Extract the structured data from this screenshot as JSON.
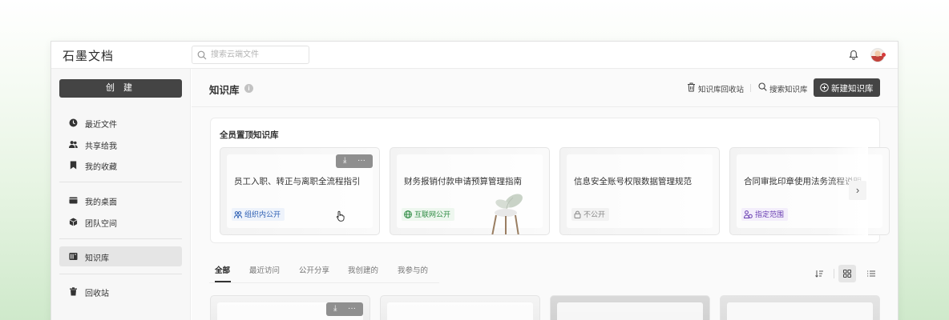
{
  "app": {
    "logo": "石墨文档"
  },
  "search": {
    "placeholder": "搜索云端文件"
  },
  "sidebar": {
    "create_label": "创 建",
    "items": [
      {
        "label": "最近文件",
        "icon": "clock-icon"
      },
      {
        "label": "共享给我",
        "icon": "users-icon"
      },
      {
        "label": "我的收藏",
        "icon": "bookmark-icon"
      },
      {
        "label": "我的桌面",
        "icon": "desktop-icon"
      },
      {
        "label": "团队空间",
        "icon": "cube-icon"
      },
      {
        "label": "知识库",
        "icon": "book-icon",
        "active": true
      },
      {
        "label": "回收站",
        "icon": "trash-icon"
      }
    ]
  },
  "header": {
    "title": "知识库",
    "recycle_label": "知识库回收站",
    "search_label": "搜索知识库",
    "new_label": "新建知识库"
  },
  "pinned": {
    "title": "全员置顶知识库",
    "cards": [
      {
        "title": "员工入职、转正与离职全流程指引",
        "badge": "组织内公开",
        "badge_color": "#2e5fb3"
      },
      {
        "title": "财务报销付款申请预算管理指南",
        "badge": "互联网公开",
        "badge_color": "#2e8b43"
      },
      {
        "title": "信息安全账号权限数据管理规范",
        "badge": "不公开",
        "badge_color": "#888888"
      },
      {
        "title": "合同审批印章使用法务流程说明",
        "badge": "指定范围",
        "badge_color": "#6a3fb2"
      }
    ]
  },
  "tabs": [
    {
      "label": "全部",
      "active": true
    },
    {
      "label": "最近访问"
    },
    {
      "label": "公开分享"
    },
    {
      "label": "我创建的"
    },
    {
      "label": "我参与的"
    }
  ],
  "colors": {
    "primary_dark": "#444444",
    "accent_green": "#2e8b43"
  }
}
